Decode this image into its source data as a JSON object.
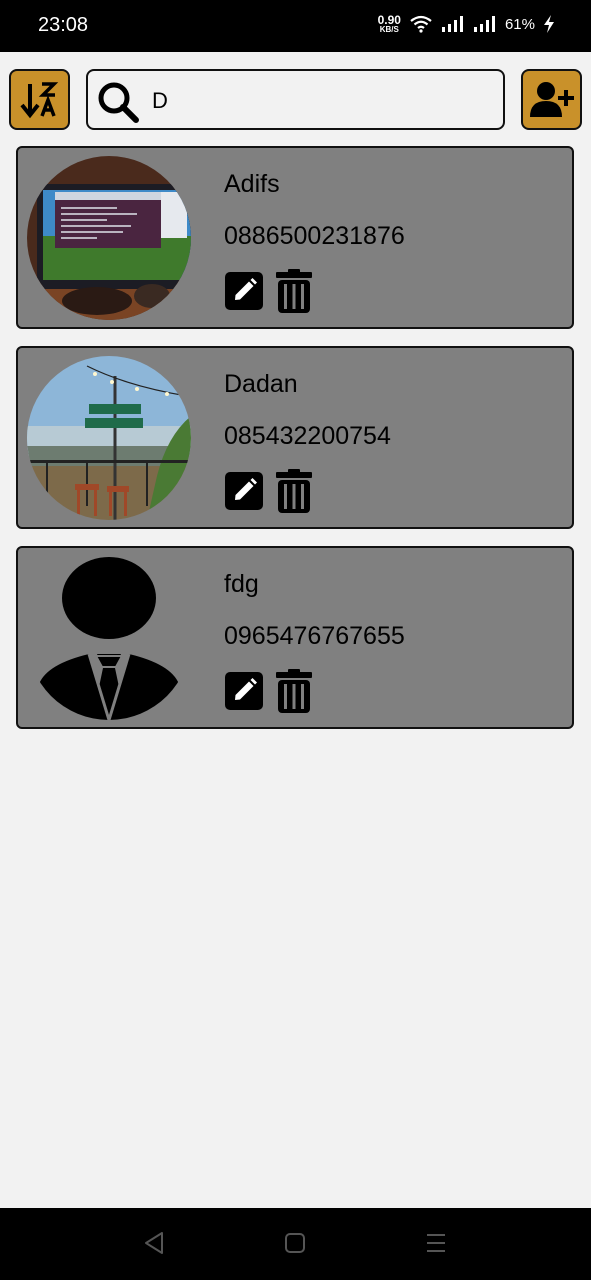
{
  "status_bar": {
    "time": "23:08",
    "net_speed_value": "0.90",
    "net_speed_unit": "KB/S",
    "battery": "61%",
    "icons": [
      "wifi-icon",
      "signal-icon",
      "signal-icon",
      "battery-charging-icon"
    ]
  },
  "toolbar": {
    "sort_icon": "sort-z-a-icon",
    "search_icon": "search-icon",
    "search_value": "D",
    "add_icon": "add-contact-icon",
    "accent_color": "#c9912a"
  },
  "contacts": [
    {
      "name": "Adifs",
      "phone": "0886500231876",
      "avatar": "photo-monitor"
    },
    {
      "name": "Dadan",
      "phone": "085432200754",
      "avatar": "photo-outdoor"
    },
    {
      "name": "fdg",
      "phone": "0965476767655",
      "avatar": "default-person-icon"
    }
  ],
  "card_color": "#808080",
  "nav_bar": {
    "icons": [
      "back-icon",
      "home-icon",
      "menu-icon"
    ]
  }
}
